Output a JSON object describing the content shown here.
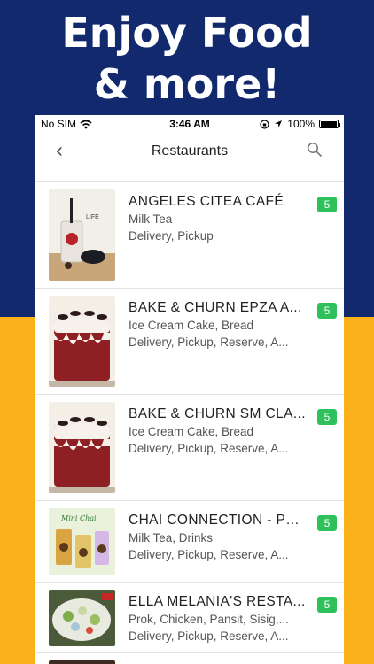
{
  "headline": [
    "Enjoy Food",
    "& more!"
  ],
  "status_bar": {
    "carrier": "No SIM",
    "time": "3:46 AM",
    "battery": "100%"
  },
  "nav": {
    "title": "Restaurants",
    "back_icon": "chevron-left-icon",
    "search_icon": "search-icon"
  },
  "colors": {
    "top_background": "#12296e",
    "bottom_background": "#fbb21a",
    "badge": "#2ec05a"
  },
  "restaurants": [
    {
      "name": "ANGELES CITEA CAFÉ",
      "category": "Milk Tea",
      "services": "Delivery, Pickup",
      "badge": "5"
    },
    {
      "name": "BAKE & CHURN EPZA A...",
      "category": "Ice Cream Cake, Bread",
      "services": "Delivery, Pickup, Reserve, A...",
      "badge": "5"
    },
    {
      "name": "BAKE & CHURN SM CLA...",
      "category": "Ice Cream Cake, Bread",
      "services": "Delivery, Pickup, Reserve, A...",
      "badge": "5"
    },
    {
      "name": "CHAI CONNECTION - PU...",
      "category": "Milk Tea, Drinks",
      "services": "Delivery, Pickup, Reserve, A...",
      "badge": "5"
    },
    {
      "name": "ELLA MELANIA'S RESTA...",
      "category": "Prok, Chicken, Pansit, Sisig,...",
      "services": "Delivery, Pickup, Reserve, A...",
      "badge": "5"
    }
  ],
  "thumb_texts": {
    "milk_tea_label": "LIFE",
    "chai_label": "Mini Chai"
  }
}
